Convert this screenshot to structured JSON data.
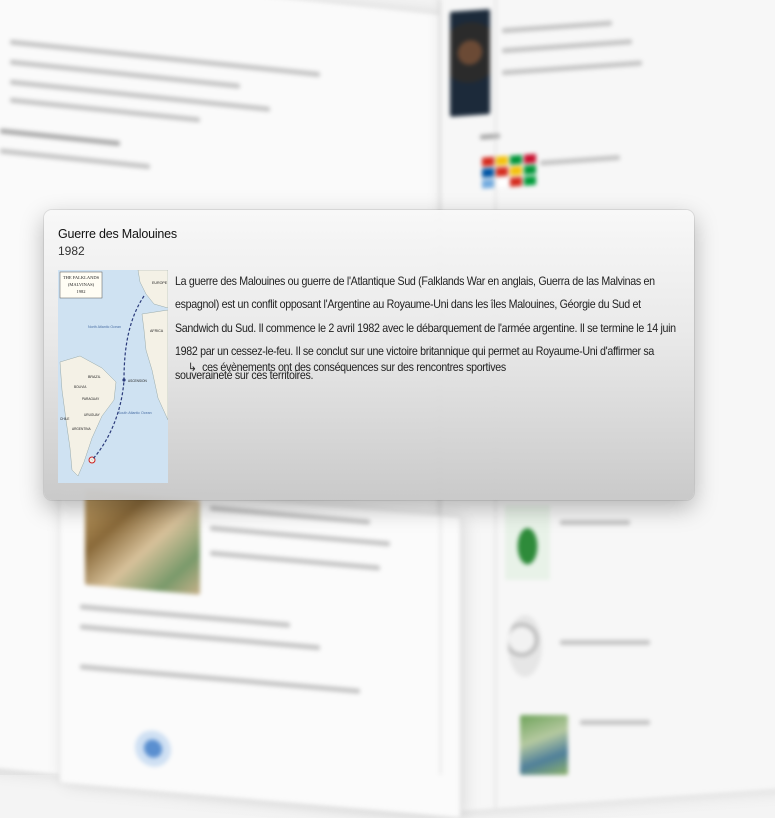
{
  "card": {
    "title": "Guerre des Malouines",
    "year": "1982",
    "description": "La guerre des Malouines ou guerre de l'Atlantique Sud (Falklands War en anglais, Guerra de las Malvinas en espagnol) est un conflit opposant l'Argentine au Royaume-Uni dans les îles Malouines, Géorgie du Sud et Sandwich du Sud. Il commence le 2 avril 1982 avec le débarquement de l'armée argentine. Il se termine le 14 juin 1982 par un cessez-le-feu. Il se conclut sur une victoire britannique qui permet au Royaume-Uni d'affirmer sa souveraineté sur ces territoires.",
    "link_arrow": "↳",
    "link_text": "ces évènements ont des conséquences sur des rencontres sportives",
    "map": {
      "title_line1": "THE FALKLANDS",
      "title_line2": "(MALVINAS)",
      "title_line3": "1982",
      "label_europe": "EUROPE",
      "label_north_atlantic": "North Atlantic Ocean",
      "label_africa": "AFRICA",
      "label_brazil": "BRAZIL",
      "label_bolivia": "BOLIVIA",
      "label_paraguay": "PARAGUAY",
      "label_chile": "CHILE",
      "label_uruguay": "URUGUAY",
      "label_argentina": "ARGENTINA",
      "label_ascension": "ASCENSION",
      "label_south_atlantic": "South Atlantic Ocean"
    }
  },
  "colors": {
    "ocean": "#cfe2f2",
    "land": "#f4f1e6",
    "route": "#2a3a7a",
    "card_text": "#222222"
  }
}
